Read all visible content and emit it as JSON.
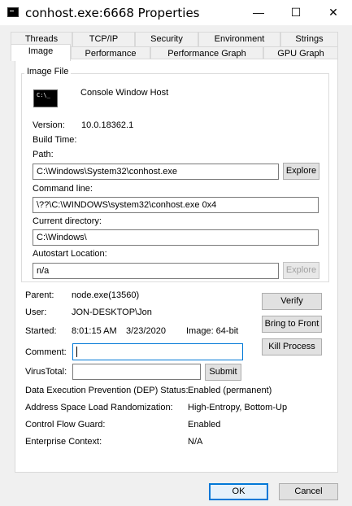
{
  "window": {
    "title": "conhost.exe:6668 Properties",
    "minimize": "—",
    "maximize": "☐",
    "close": "✕"
  },
  "tabs_row1": [
    "Threads",
    "TCP/IP",
    "Security",
    "Environment",
    "Strings"
  ],
  "tabs_row2": [
    "Image",
    "Performance",
    "Performance Graph",
    "GPU Graph"
  ],
  "active_tab": "Image",
  "image_file": {
    "group_label": "Image File",
    "icon_text": "C:\\_",
    "description": "Console Window Host",
    "version_label": "Version:",
    "version_value": "10.0.18362.1",
    "build_time_label": "Build Time:",
    "path_label": "Path:",
    "path_value": "C:\\Windows\\System32\\conhost.exe",
    "explore_label": "Explore",
    "command_line_label": "Command line:",
    "command_line_value": "\\??\\C:\\WINDOWS\\system32\\conhost.exe 0x4",
    "current_dir_label": "Current directory:",
    "current_dir_value": "C:\\Windows\\",
    "autostart_label": "Autostart Location:",
    "autostart_value": "n/a",
    "autostart_explore_label": "Explore"
  },
  "process": {
    "parent_label": "Parent:",
    "parent_value": "node.exe(13560)",
    "user_label": "User:",
    "user_value": "JON-DESKTOP\\Jon",
    "started_label": "Started:",
    "started_time": "8:01:15 AM",
    "started_date": "3/23/2020",
    "image_bits": "Image: 64-bit",
    "comment_label": "Comment:",
    "comment_value": "",
    "virustotal_label": "VirusTotal:",
    "virustotal_value": "",
    "submit_label": "Submit"
  },
  "actions": {
    "verify": "Verify",
    "bring_to_front": "Bring to Front",
    "kill_process": "Kill Process"
  },
  "security_info": [
    {
      "label": "Data Execution Prevention (DEP) Status:",
      "value": "Enabled (permanent)"
    },
    {
      "label": "Address Space Load Randomization:",
      "value": "High-Entropy, Bottom-Up"
    },
    {
      "label": "Control Flow Guard:",
      "value": "Enabled"
    },
    {
      "label": "Enterprise Context:",
      "value": "N/A"
    }
  ],
  "footer": {
    "ok": "OK",
    "cancel": "Cancel"
  }
}
